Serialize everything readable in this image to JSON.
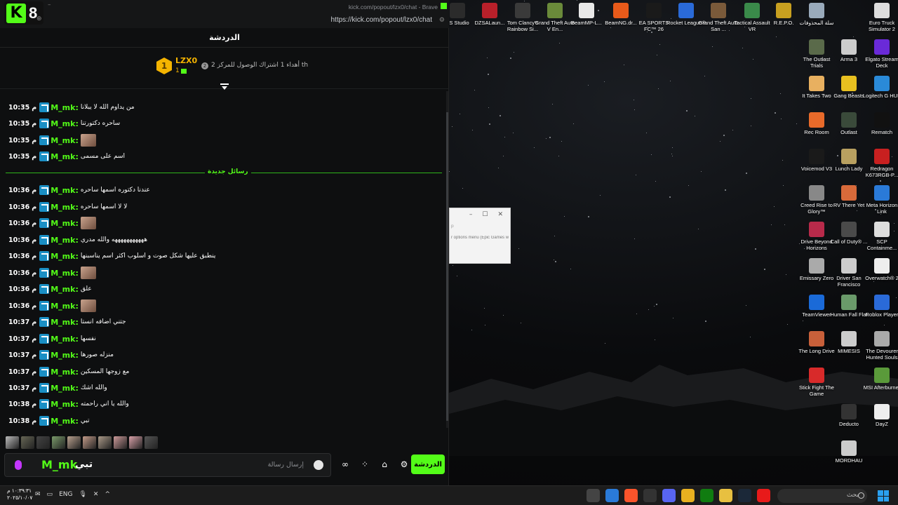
{
  "browser": {
    "title": "kick.com/popout/lzx0/chat - Brave",
    "url": "https://kick.com/popout/lzx0/chat",
    "tab_badge_number": "8"
  },
  "chat": {
    "header": "الدردشة",
    "pinned": {
      "rank": "1",
      "username": "LZX0",
      "count": "1",
      "badge": "2",
      "text": "أهداء 1 اشتراك الوصول للمركز 2 th"
    },
    "new_messages_divider": "رسائل جديدة",
    "messages": [
      {
        "time": "10:35",
        "ampm": "م",
        "user": "M_mk:",
        "text": "من يداوم الله لا يبلانا"
      },
      {
        "time": "10:35",
        "ampm": "م",
        "user": "M_mk:",
        "text": "ساحره دكتورتنا"
      },
      {
        "time": "10:35",
        "ampm": "م",
        "user": "M_mk:",
        "text": ""
      },
      {
        "time": "10:35",
        "ampm": "م",
        "user": "M_mk:",
        "text": "اسم على مسمى"
      },
      {
        "time": "10:36",
        "ampm": "م",
        "user": "M_mk:",
        "text": "عندنا دكتوره اسمها ساحره"
      },
      {
        "time": "10:36",
        "ampm": "م",
        "user": "M_mk:",
        "text": "لا لا اسمها ساحره"
      },
      {
        "time": "10:36",
        "ampm": "م",
        "user": "M_mk:",
        "text": ""
      },
      {
        "time": "10:36",
        "ampm": "م",
        "user": "M_mk:",
        "text": "هههههههههههه والله مدري"
      },
      {
        "time": "10:36",
        "ampm": "م",
        "user": "M_mk:",
        "text": "ينطبق عليها شكل صوت و اسلوب اكثر اسم يناسبنها"
      },
      {
        "time": "10:36",
        "ampm": "م",
        "user": "M_mk:",
        "text": ""
      },
      {
        "time": "10:36",
        "ampm": "م",
        "user": "M_mk:",
        "text": "علق"
      },
      {
        "time": "10:36",
        "ampm": "م",
        "user": "M_mk:",
        "text": ""
      },
      {
        "time": "10:37",
        "ampm": "م",
        "user": "M_mk:",
        "text": "جتني اضافه انستا"
      },
      {
        "time": "10:37",
        "ampm": "م",
        "user": "M_mk:",
        "text": "نفسها"
      },
      {
        "time": "10:37",
        "ampm": "م",
        "user": "M_mk:",
        "text": "منزله صورها"
      },
      {
        "time": "10:37",
        "ampm": "م",
        "user": "M_mk:",
        "text": "مع زوجها المسكين"
      },
      {
        "time": "10:37",
        "ampm": "م",
        "user": "M_mk:",
        "text": "والله اشك"
      },
      {
        "time": "10:38",
        "ampm": "م",
        "user": "M_mk:",
        "text": "والله يا اني راحمته"
      },
      {
        "time": "10:38",
        "ampm": "م",
        "user": "M_mk:",
        "text": "تبي"
      }
    ],
    "composer": {
      "username": "M_mk",
      "value": "تبي",
      "placeholder": "إرسال رسالة"
    },
    "send_label": "الدردشة"
  },
  "floating_window": {
    "line1": "p",
    "line2": "r options menu (Epic Games w"
  },
  "desktop_icons": [
    {
      "label": "BS Studio",
      "color": "#2b2b2b"
    },
    {
      "label": "DZSALaun...",
      "color": "#b8202a"
    },
    {
      "label": "Tom Clancy's Rainbow Si...",
      "color": "#3a3a3a"
    },
    {
      "label": "Grand Theft Auto V En...",
      "color": "#6a8a3a"
    },
    {
      "label": "BeamMP-L...",
      "color": "#e8e8e8"
    },
    {
      "label": "BeamNG.dr...",
      "color": "#e85a1a"
    },
    {
      "label": "EA SPORTS FC™ 26",
      "color": "#1a1a1a"
    },
    {
      "label": "Rocket League®",
      "color": "#2a6ad8"
    },
    {
      "label": "Grand Theft Auto San ...",
      "color": "#7a5a3a"
    },
    {
      "label": "Tactical Assault VR",
      "color": "#3a8a4a"
    },
    {
      "label": "R.E.P.O.",
      "color": "#c8a020"
    },
    {
      "label": "سلة المحذوفات",
      "color": "#9ab"
    },
    {
      "label": "Euro Truck Simulator 2",
      "color": "#ddd"
    },
    {
      "label": "The Outlast Trials",
      "color": "#5a6a4a"
    },
    {
      "label": "Arma 3",
      "color": "#ccc"
    },
    {
      "label": "Elgato Stream Deck",
      "color": "#6a2ad8"
    },
    {
      "label": "It Takes Two",
      "color": "#e8b060"
    },
    {
      "label": "Gang Beasts",
      "color": "#e8c020"
    },
    {
      "label": "Logitech G HUB",
      "color": "#2a8ad8"
    },
    {
      "label": "Rec Room",
      "color": "#e86a2a"
    },
    {
      "label": "Outlast",
      "color": "#3a4a3a"
    },
    {
      "label": "Rematch",
      "color": "#111"
    },
    {
      "label": "Voicemod V3",
      "color": "#1a1a1a"
    },
    {
      "label": "Lunch Lady",
      "color": "#b8a060"
    },
    {
      "label": "Redragon K673RGB-P...",
      "color": "#c82020"
    },
    {
      "label": "Creed Rise to Glory™",
      "color": "#888"
    },
    {
      "label": "RV There Yet",
      "color": "#d86a3a"
    },
    {
      "label": "Meta Horizon Link",
      "color": "#2a7ad8"
    },
    {
      "label": "Drive Beyond Horizons",
      "color": "#b82a4a"
    },
    {
      "label": "Call of Duty® ...",
      "color": "#4a4a4a"
    },
    {
      "label": "SCP Containme...",
      "color": "#ddd"
    },
    {
      "label": "Emissary Zero",
      "color": "#aaa"
    },
    {
      "label": "Driver San Francisco",
      "color": "#ccc"
    },
    {
      "label": "Overwatch® 2",
      "color": "#eee"
    },
    {
      "label": "TeamViewer",
      "color": "#1a6ad8"
    },
    {
      "label": "Human Fall Flat",
      "color": "#6a9a6a"
    },
    {
      "label": "Roblox Player",
      "color": "#2a6ad8"
    },
    {
      "label": "The Long Drive",
      "color": "#c8603a"
    },
    {
      "label": "MIMESIS",
      "color": "#ccc"
    },
    {
      "label": "The Devourer Hunted Souls",
      "color": "#aaa"
    },
    {
      "label": "Stick Fight The Game",
      "color": "#d82a2a"
    },
    {
      "label": "MSI Afterburner",
      "color": "#5a9a3a"
    },
    {
      "label": "Deducto",
      "color": "#333"
    },
    {
      "label": "DayZ",
      "color": "#eee"
    },
    {
      "label": "MORDHAU",
      "color": "#ccc"
    }
  ],
  "taskbar": {
    "time": "١٠:٣٩:٣١ م",
    "date": "٢٠٢٥/١٠/٠٧",
    "lang": "ENG",
    "search_placeholder": "بحث"
  }
}
